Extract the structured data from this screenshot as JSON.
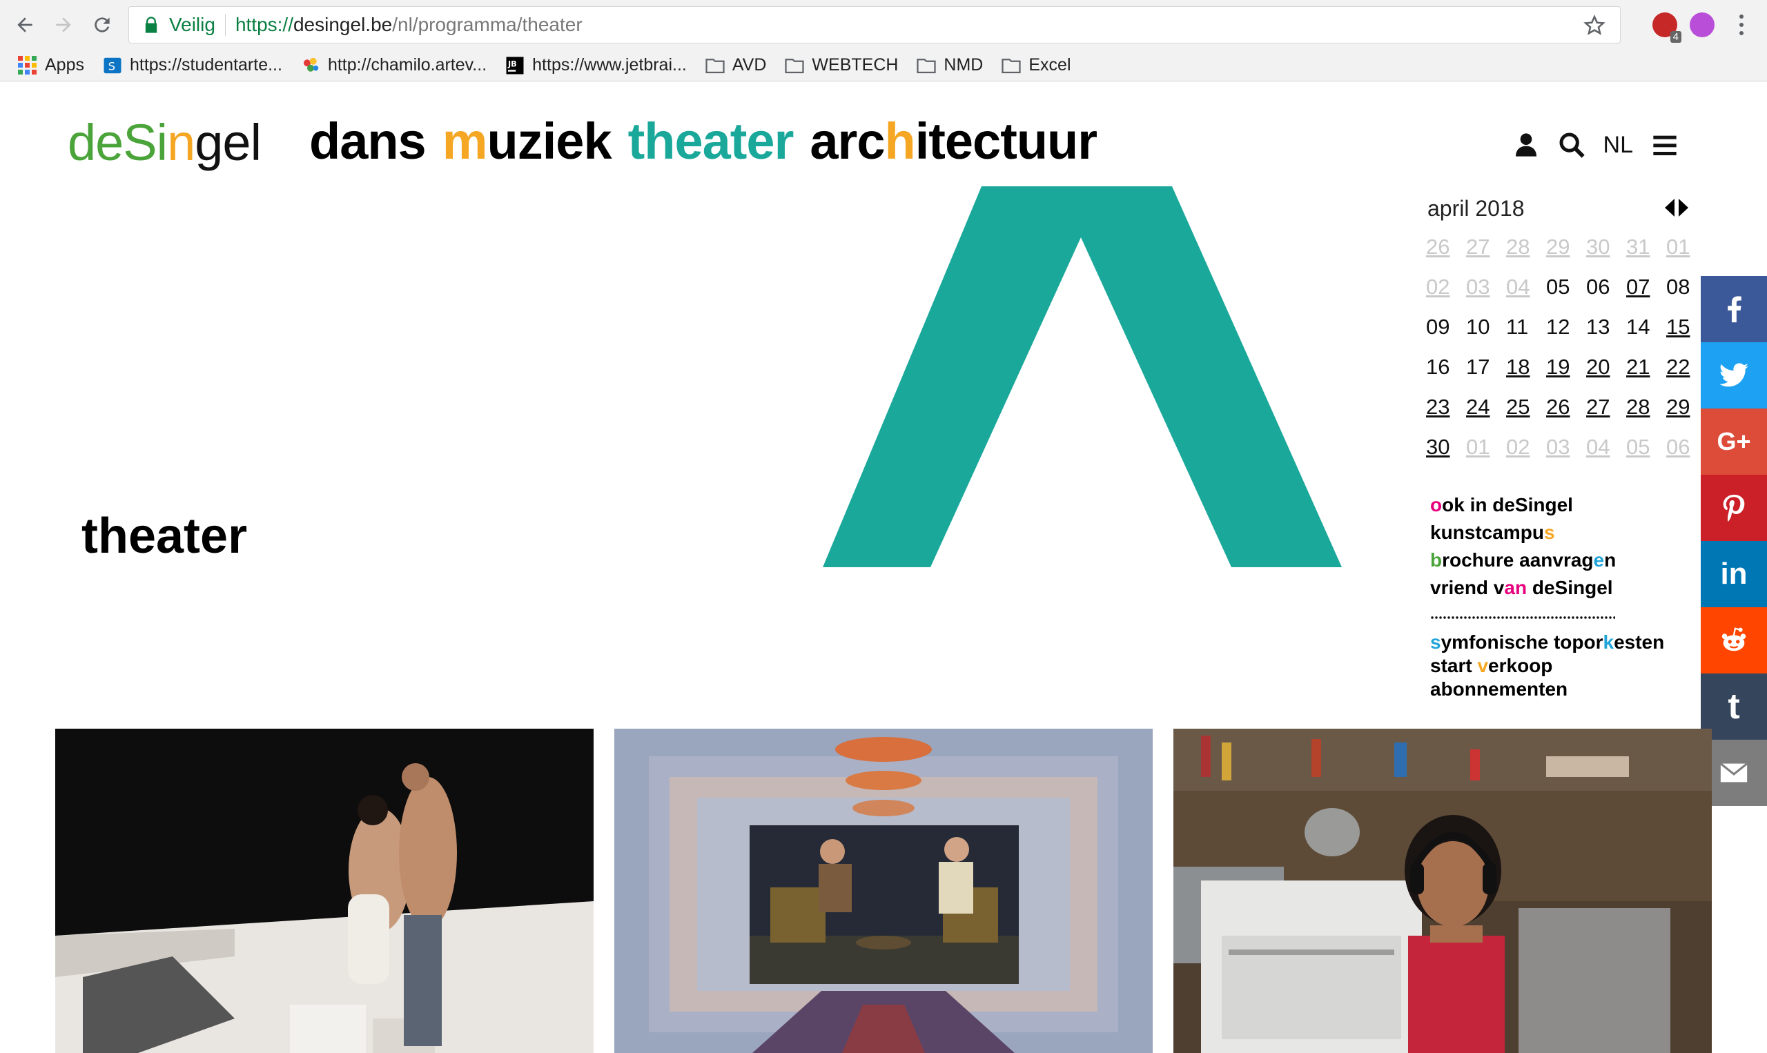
{
  "browser": {
    "secure_label": "Veilig",
    "url_scheme": "https://",
    "url_host": "desingel.be",
    "url_path": "/nl/programma/theater",
    "extension_badge": "4",
    "bookmarks": [
      {
        "label": "Apps",
        "icon": "apps-grid-icon"
      },
      {
        "label": "https://studentarte...",
        "icon": "sharepoint-icon"
      },
      {
        "label": "http://chamilo.artev...",
        "icon": "chamilo-icon"
      },
      {
        "label": "https://www.jetbrai...",
        "icon": "jetbrains-icon"
      },
      {
        "label": "AVD",
        "icon": "folder-icon"
      },
      {
        "label": "WEBTECH",
        "icon": "folder-icon"
      },
      {
        "label": "NMD",
        "icon": "folder-icon"
      },
      {
        "label": "Excel",
        "icon": "folder-icon"
      }
    ]
  },
  "site": {
    "logo": {
      "part1": "deSi",
      "part2": "n",
      "part3": "gel"
    },
    "nav": {
      "dans": "dans",
      "muziek_m": "m",
      "muziek_rest": "uziek",
      "theater": "theater",
      "arch_a": "arc",
      "arch_h": "h",
      "arch_rest": "itectuur"
    },
    "lang": "NL",
    "page_title": "theater",
    "colors": {
      "teal": "#1aa89b",
      "orange": "#f5a623",
      "pink": "#e6007e",
      "green": "#4aa43a",
      "blue": "#1fa3d9"
    }
  },
  "calendar": {
    "month": "april 2018",
    "days": [
      {
        "d": "26",
        "s": "muted"
      },
      {
        "d": "27",
        "s": "muted"
      },
      {
        "d": "28",
        "s": "muted"
      },
      {
        "d": "29",
        "s": "muted"
      },
      {
        "d": "30",
        "s": "muted"
      },
      {
        "d": "31",
        "s": "muted"
      },
      {
        "d": "01",
        "s": "muted"
      },
      {
        "d": "02",
        "s": "muted"
      },
      {
        "d": "03",
        "s": "muted"
      },
      {
        "d": "04",
        "s": "muted"
      },
      {
        "d": "05",
        "s": "plain"
      },
      {
        "d": "06",
        "s": "plain"
      },
      {
        "d": "07",
        "s": "link"
      },
      {
        "d": "08",
        "s": "plain"
      },
      {
        "d": "09",
        "s": "plain"
      },
      {
        "d": "10",
        "s": "plain"
      },
      {
        "d": "11",
        "s": "plain"
      },
      {
        "d": "12",
        "s": "plain"
      },
      {
        "d": "13",
        "s": "plain"
      },
      {
        "d": "14",
        "s": "plain"
      },
      {
        "d": "15",
        "s": "link"
      },
      {
        "d": "16",
        "s": "plain"
      },
      {
        "d": "17",
        "s": "plain"
      },
      {
        "d": "18",
        "s": "link"
      },
      {
        "d": "19",
        "s": "link"
      },
      {
        "d": "20",
        "s": "link"
      },
      {
        "d": "21",
        "s": "link"
      },
      {
        "d": "22",
        "s": "link"
      },
      {
        "d": "23",
        "s": "link"
      },
      {
        "d": "24",
        "s": "link"
      },
      {
        "d": "25",
        "s": "link"
      },
      {
        "d": "26",
        "s": "link"
      },
      {
        "d": "27",
        "s": "link"
      },
      {
        "d": "28",
        "s": "link"
      },
      {
        "d": "29",
        "s": "link"
      },
      {
        "d": "30",
        "s": "link"
      },
      {
        "d": "01",
        "s": "muted"
      },
      {
        "d": "02",
        "s": "muted"
      },
      {
        "d": "03",
        "s": "muted"
      },
      {
        "d": "04",
        "s": "muted"
      },
      {
        "d": "05",
        "s": "muted"
      },
      {
        "d": "06",
        "s": "muted"
      }
    ]
  },
  "side_links": {
    "ook_a": "o",
    "ook_b": "ok in deSingel",
    "kunst_a": "kunstcampu",
    "kunst_b": "s",
    "bro_a": "b",
    "bro_b": "rochure aanvrag",
    "bro_c": "e",
    "bro_d": "n",
    "vriend_a": "vriend v",
    "vriend_b": "an",
    "vriend_c": " deSingel",
    "symf_a": "s",
    "symf_b": "ymfonische topor",
    "symf_c": "k",
    "symf_d": "esten",
    "start_a": "start ",
    "start_b": "v",
    "start_c": "erkoop",
    "abonnementen": "abonnementen"
  },
  "social": [
    {
      "name": "facebook",
      "color": "#3b5998",
      "glyph": "f"
    },
    {
      "name": "twitter",
      "color": "#1da1f2",
      "glyph": ""
    },
    {
      "name": "google-plus",
      "color": "#dd4b39",
      "glyph": "G+"
    },
    {
      "name": "pinterest",
      "color": "#cb2027",
      "glyph": "P"
    },
    {
      "name": "linkedin",
      "color": "#0077b5",
      "glyph": "in"
    },
    {
      "name": "reddit",
      "color": "#ff4500",
      "glyph": ""
    },
    {
      "name": "tumblr",
      "color": "#35465c",
      "glyph": "t"
    },
    {
      "name": "email",
      "color": "#7d7d7d",
      "glyph": ""
    }
  ]
}
